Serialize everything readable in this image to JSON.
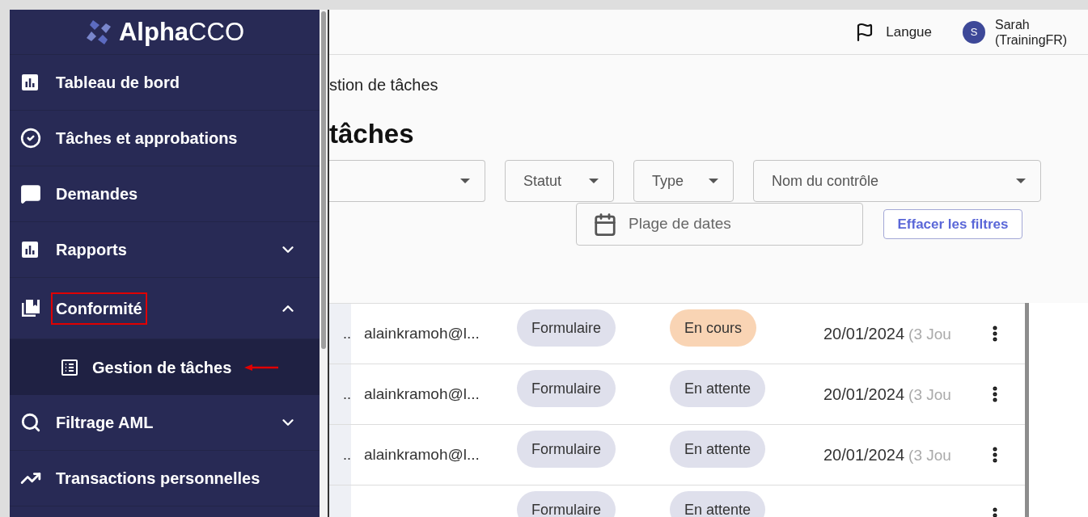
{
  "sidebar": {
    "logo": "**Alpha**CCO",
    "items": [
      {
        "kind": "link",
        "label": "Tableau de bord"
      },
      {
        "kind": "link",
        "label": "Tâches et approbations"
      },
      {
        "kind": "link",
        "label": "Demandes"
      },
      {
        "kind": "group",
        "label": "Rapports",
        "expanded": false,
        "annotated": false
      },
      {
        "kind": "group",
        "label": "Conformité",
        "expanded": true,
        "annotated": true,
        "children": [
          {
            "label": "Gestion de tâches",
            "selected": true,
            "annotated": true
          }
        ]
      },
      {
        "kind": "group",
        "label": "Filtrage AML",
        "expanded": false,
        "annotated": false
      },
      {
        "kind": "link",
        "label": "Transactions personnelles"
      }
    ]
  },
  "header": {
    "language": "Langue",
    "user": {
      "initial": "S",
      "name": "Sarah (TrainingFR)"
    }
  },
  "breadcrumb": "stion de tâches",
  "title": "tâches",
  "filters": [
    {
      "label": "Statut"
    },
    {
      "label": "Type"
    },
    {
      "label": "Nom du contrôle"
    }
  ],
  "date_range": {
    "placeholder": "Plage de dates"
  },
  "clear_button": "Effacer les filtres",
  "table": {
    "rows": [
      {
        "column_1": "..",
        "email": "alainkramoh@l...",
        "type": "Formulaire",
        "status": {
          "kind": "in_progress",
          "label": "En cours"
        },
        "date": "20/01/2024",
        "relative": "(3 Jou"
      },
      {
        "column_1": "..",
        "email": "alainkramoh@l...",
        "type": "Formulaire",
        "status": {
          "kind": "pending",
          "label": "En attente"
        },
        "date": "20/01/2024",
        "relative": "(3 Jou"
      },
      {
        "column_1": "..",
        "email": "alainkramoh@l...",
        "type": "Formulaire",
        "status": {
          "kind": "pending",
          "label": "En attente"
        },
        "date": "20/01/2024",
        "relative": "(3 Jou"
      },
      {
        "type": "Formulaire",
        "status": {
          "kind": "pending",
          "label": "En attente"
        }
      }
    ]
  }
}
